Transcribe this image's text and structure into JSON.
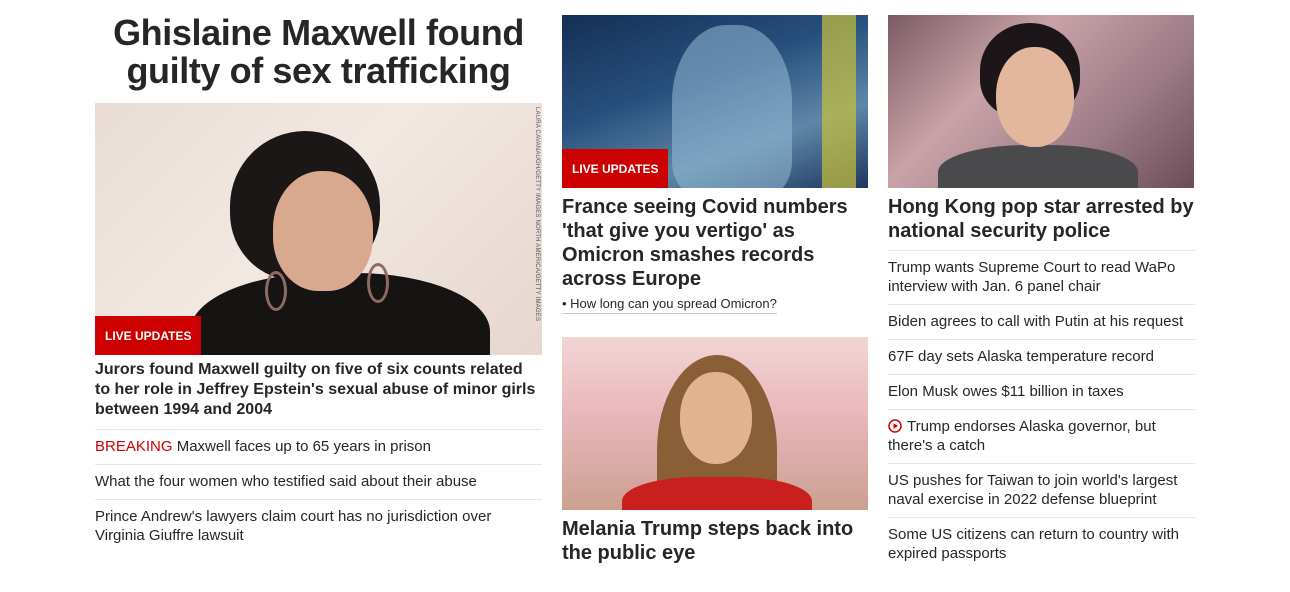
{
  "column1": {
    "main_headline": "Ghislaine Maxwell found guilty of sex trafficking",
    "photo_credit": "LAURA CAVANAUGH/GETTY IMAGES NORTH AMERICA/GETTY IMAGES",
    "badge": "LIVE UPDATES",
    "lead_text": "Jurors found Maxwell guilty on five of six counts related to her role in Jeffrey Epstein's sexual abuse of minor girls between 1994 and 2004",
    "links": [
      {
        "prefix": "BREAKING",
        "text": " Maxwell faces up to 65 years in prison"
      },
      {
        "text": "What the four women who testified said about their abuse"
      },
      {
        "text": "Prince Andrew's lawyers claim court has no jurisdiction over Virginia Giuffre lawsuit"
      }
    ]
  },
  "column2": {
    "story1": {
      "badge": "LIVE UPDATES",
      "headline": "France seeing Covid numbers 'that give you vertigo' as Omicron smashes records across Europe",
      "sublink": "• How long can you spread Omicron?"
    },
    "story2": {
      "headline": "Melania Trump steps back into the public eye"
    }
  },
  "column3": {
    "headline": "Hong Kong pop star arrested by national security police",
    "links": [
      {
        "text": "Trump wants Supreme Court to read WaPo interview with Jan. 6 panel chair"
      },
      {
        "text": "Biden agrees to call with Putin at his request"
      },
      {
        "text": "67F day sets Alaska temperature record"
      },
      {
        "text": "Elon Musk owes $11 billion in taxes"
      },
      {
        "text": "Trump endorses Alaska governor, but there's a catch",
        "icon": "play-circle-icon"
      },
      {
        "text": "US pushes for Taiwan to join world's largest naval exercise in 2022 defense blueprint"
      },
      {
        "text": "Some US citizens can return to country with expired passports"
      }
    ]
  },
  "colors": {
    "accent_red": "#cc0000",
    "text": "#262626",
    "divider": "#e6e6e6"
  }
}
